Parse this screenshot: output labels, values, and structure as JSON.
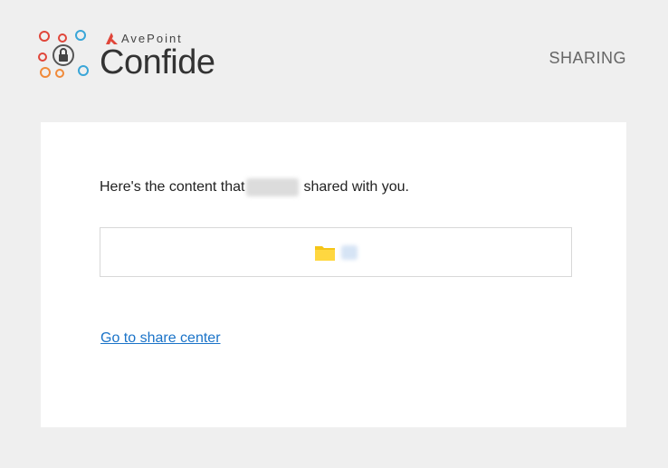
{
  "header": {
    "brand_company": "AvePoint",
    "brand_product": "Confide",
    "section_label": "SHARING"
  },
  "card": {
    "message_before": "Here's the content that",
    "message_after": "shared with you.",
    "item_icon": "folder-icon",
    "link_label": "Go to share center"
  },
  "colors": {
    "background": "#efefef",
    "card": "#ffffff",
    "link": "#1a73c8",
    "folder": "#f5c518",
    "logo_red": "#e0463a",
    "logo_orange": "#f08a3a",
    "logo_blue": "#3aa6d8"
  }
}
